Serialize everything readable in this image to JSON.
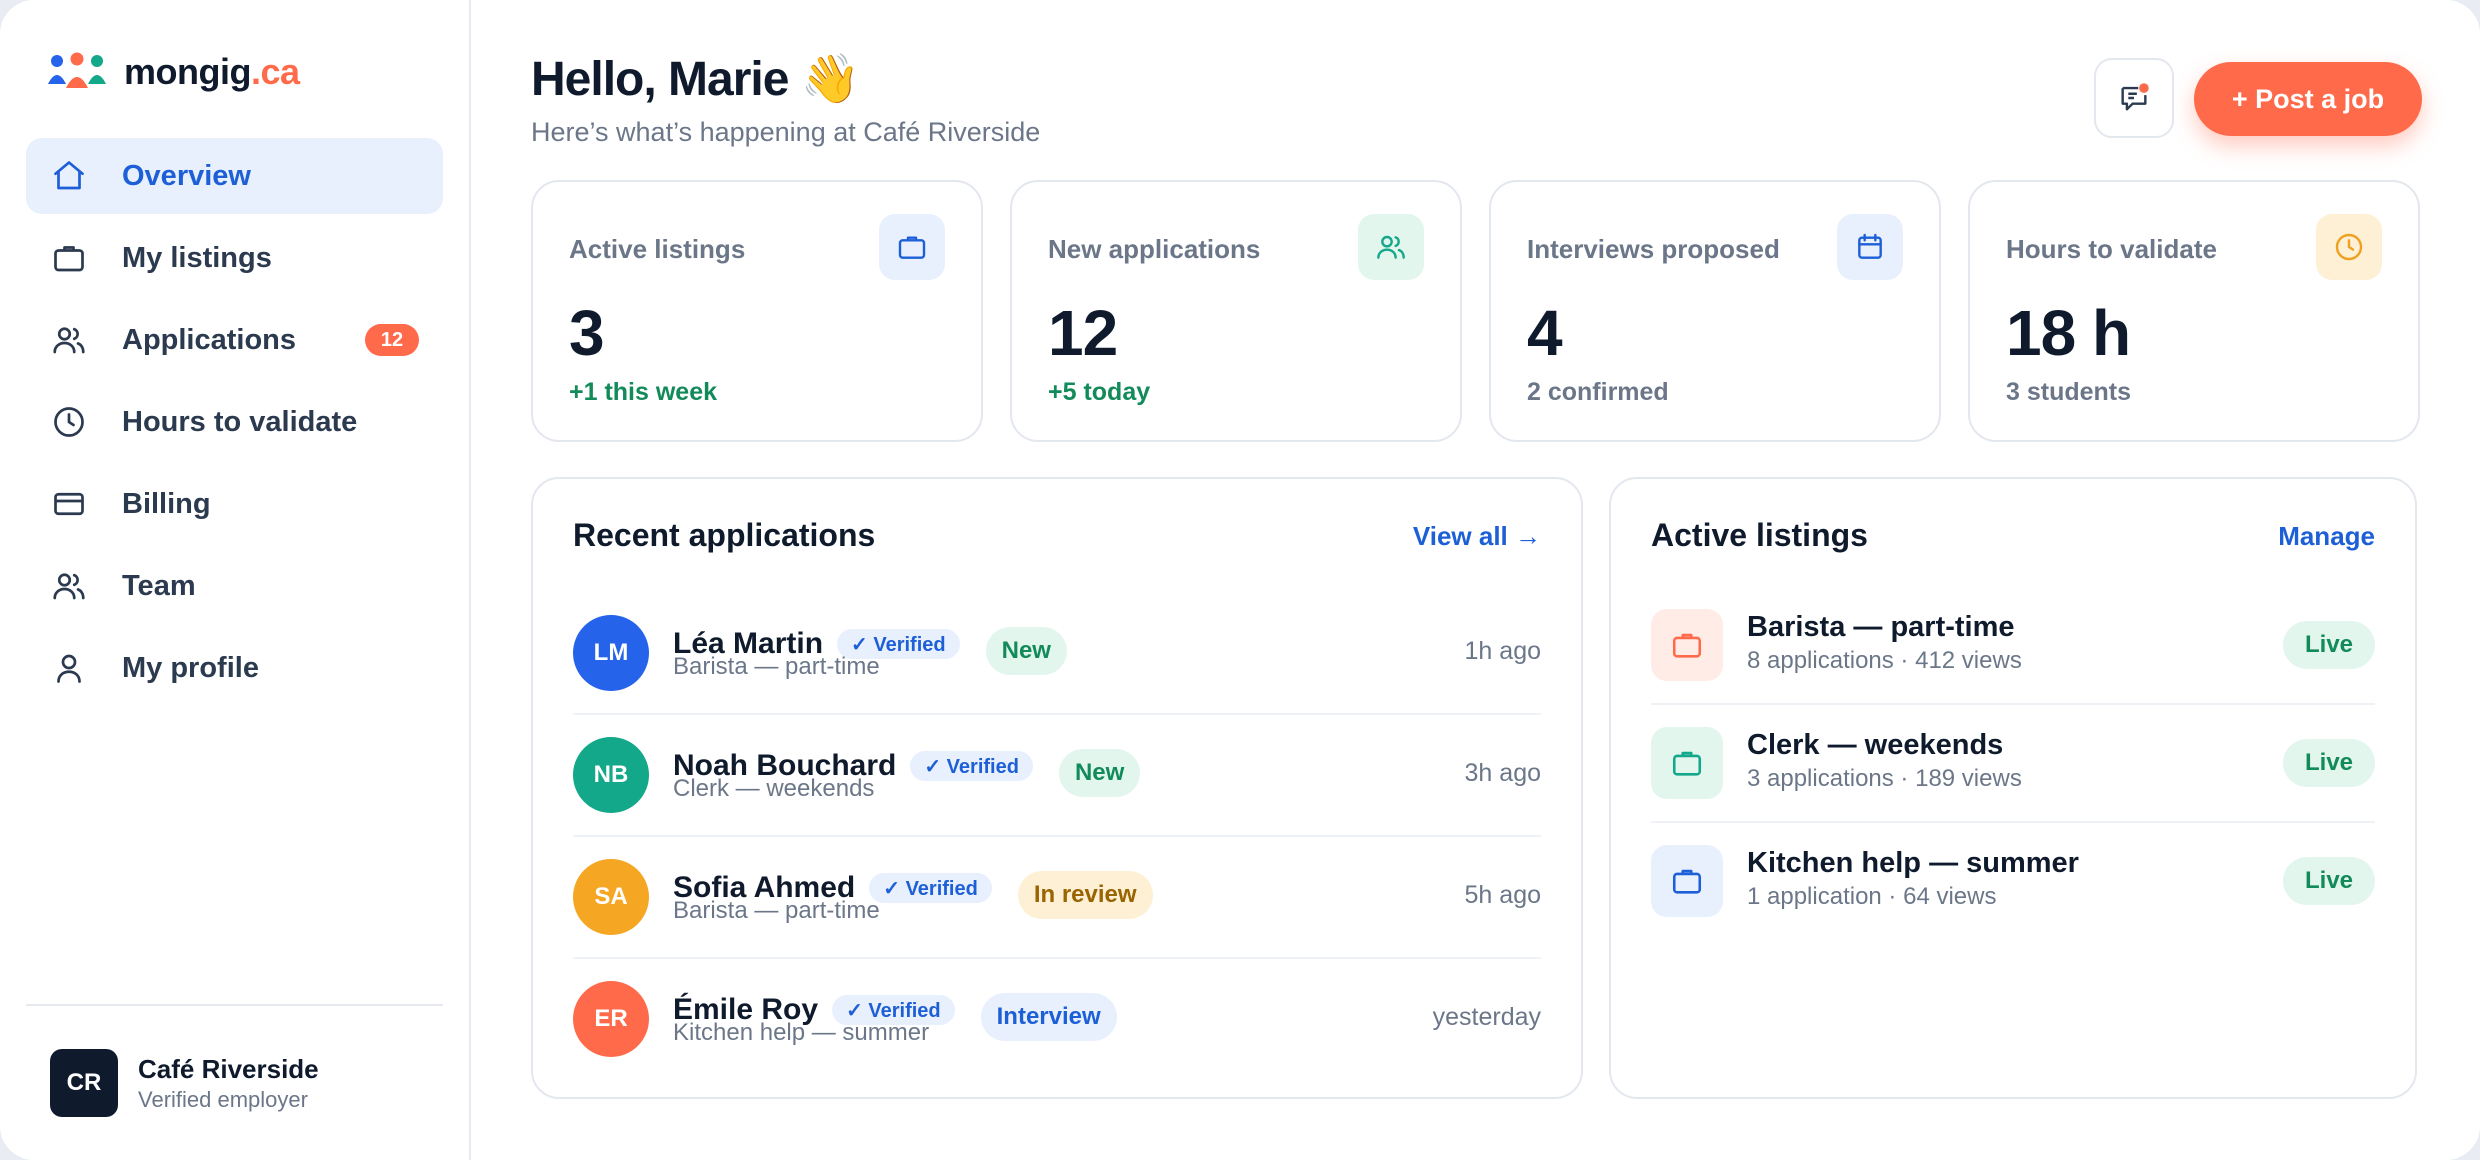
{
  "brand": {
    "name": "mongig",
    "tld": ".ca",
    "logo_icon": "people-group-icon"
  },
  "sidebar": {
    "items": [
      {
        "label": "Overview",
        "icon": "home-icon",
        "active": true
      },
      {
        "label": "My listings",
        "icon": "briefcase-icon"
      },
      {
        "label": "Applications",
        "icon": "users-icon",
        "badge": "12"
      },
      {
        "label": "Hours to validate",
        "icon": "clock-icon"
      },
      {
        "label": "Billing",
        "icon": "credit-card-icon"
      },
      {
        "label": "Team",
        "icon": "users-icon"
      },
      {
        "label": "My profile",
        "icon": "user-icon"
      }
    ],
    "footer": {
      "initials": "CR",
      "name": "Café Riverside",
      "subtitle": "Verified employer"
    }
  },
  "header": {
    "greeting": "Hello, Marie 👋",
    "subtitle": "Here’s what’s happening at Café Riverside",
    "notification_icon": "message-notification-icon",
    "post_button": "+ Post a job"
  },
  "stats": [
    {
      "label": "Active listings",
      "value": "3",
      "sub": "+1 this week",
      "icon": "briefcase-icon",
      "color": "#1d5fd6",
      "bg": "#e8effd"
    },
    {
      "label": "New applications",
      "value": "12",
      "sub": "+5 today",
      "icon": "users-icon",
      "color": "#13a889",
      "bg": "#e2f6ee"
    },
    {
      "label": "Interviews proposed",
      "value": "4",
      "sub": "2 confirmed",
      "icon": "calendar-icon",
      "color": "#1d5fd6",
      "bg": "#e8effd"
    },
    {
      "label": "Hours to validate",
      "value": "18 h",
      "sub": "3 students",
      "icon": "clock-icon",
      "color": "#f0a020",
      "bg": "#fdf0d5"
    }
  ],
  "recent": {
    "title": "Recent applications",
    "link": "View all →",
    "verified_label": "✓ Verified",
    "rows": [
      {
        "initials": "LM",
        "name": "Léa Martin",
        "role": "Barista — part-time",
        "status": "New",
        "time": "1h ago",
        "color": "#2563eb"
      },
      {
        "initials": "NB",
        "name": "Noah Bouchard",
        "role": "Clerk — weekends",
        "status": "New",
        "time": "3h ago",
        "color": "#13a889"
      },
      {
        "initials": "SA",
        "name": "Sofia Ahmed",
        "role": "Barista — part-time",
        "status": "In review",
        "time": "5h ago",
        "color": "#f5a623"
      },
      {
        "initials": "ER",
        "name": "Émile Roy",
        "role": "Kitchen help — summer",
        "status": "Interview",
        "time": "yesterday",
        "color": "#ff6b4a"
      }
    ]
  },
  "listings": {
    "title": "Active listings",
    "link": "Manage",
    "rows": [
      {
        "title": "Barista — part-time",
        "sub": "8 applications · 412 views",
        "status": "Live",
        "color": "#ff6b4a",
        "bg": "#ffece6"
      },
      {
        "title": "Clerk — weekends",
        "sub": "3 applications · 189 views",
        "status": "Live",
        "color": "#13a889",
        "bg": "#e2f6ee"
      },
      {
        "title": "Kitchen help — summer",
        "sub": "1 application · 64 views",
        "status": "Live",
        "color": "#1d5fd6",
        "bg": "#e8effd"
      }
    ]
  }
}
